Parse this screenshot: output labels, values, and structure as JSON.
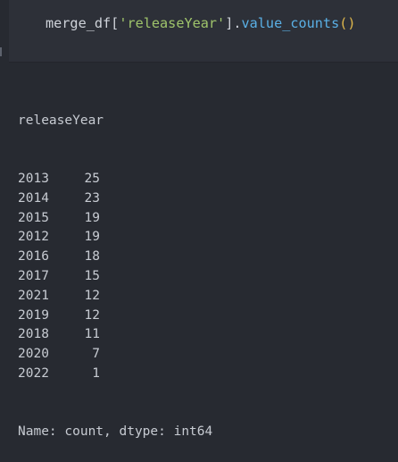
{
  "code_cell": {
    "tokens": {
      "var": "merge_df",
      "open_bracket": "[",
      "string": "'releaseYear'",
      "close_bracket": "]",
      "dot": ".",
      "method": "value_counts",
      "parens": "()"
    }
  },
  "output": {
    "index_name": "releaseYear",
    "rows": [
      {
        "year": "2013",
        "count": "25"
      },
      {
        "year": "2014",
        "count": "23"
      },
      {
        "year": "2015",
        "count": "19"
      },
      {
        "year": "2012",
        "count": "19"
      },
      {
        "year": "2016",
        "count": "18"
      },
      {
        "year": "2017",
        "count": "15"
      },
      {
        "year": "2021",
        "count": "12"
      },
      {
        "year": "2019",
        "count": "12"
      },
      {
        "year": "2018",
        "count": "11"
      },
      {
        "year": "2020",
        "count": "7"
      },
      {
        "year": "2022",
        "count": "1"
      }
    ],
    "footer": "Name: count, dtype: int64"
  }
}
